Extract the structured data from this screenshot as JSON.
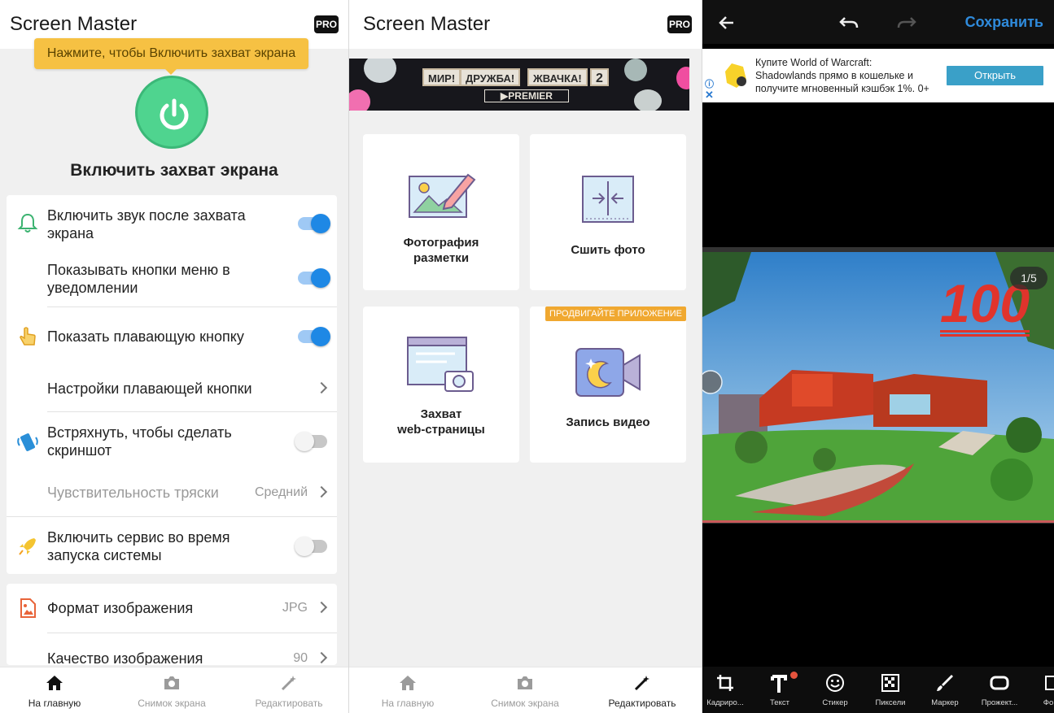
{
  "screen1": {
    "app_title": "Screen Master",
    "pro_badge": "PRO",
    "tooltip": "Нажмите, чтобы Включить захват экрана",
    "power_title": "Включить захват экрана",
    "settings": {
      "sound_after_capture": {
        "label_line1": "Включить звук после захвата",
        "label_line2": "экрана",
        "enabled": true
      },
      "menu_buttons_in_notification": {
        "label_line1": "Показывать кнопки меню в",
        "label_line2": "уведомлении",
        "enabled": true
      },
      "floating_button": {
        "label": "Показать плавающую кнопку",
        "enabled": true
      },
      "floating_button_settings": {
        "label": "Настройки плавающей кнопки"
      },
      "shake_to_screenshot": {
        "label_line1": "Встряхнуть, чтобы сделать",
        "label_line2": "скриншот",
        "enabled": false
      },
      "shake_sensitivity": {
        "label": "Чувствительность тряски",
        "value": "Средний"
      },
      "start_on_boot": {
        "label_line1": "Включить сервис во время",
        "label_line2": "запуска системы",
        "enabled": false
      },
      "image_format": {
        "label": "Формат изображения",
        "value": "JPG"
      },
      "image_quality": {
        "label": "Качество изображения",
        "value": "90"
      }
    },
    "nav": {
      "home": "На главную",
      "screenshot": "Снимок экрана",
      "edit": "Редактировать",
      "active": "home"
    }
  },
  "screen2": {
    "app_title": "Screen Master",
    "pro_badge": "PRO",
    "ad_banner": {
      "chips": [
        "МИР!",
        "ДРУЖБА!",
        "ЖВАЧКА!",
        "2"
      ],
      "sub": "▶PREMIER"
    },
    "tiles": [
      {
        "line1": "Фотография",
        "line2": "разметки",
        "icon": "markup-photo-icon"
      },
      {
        "line1": "Сшить фото",
        "line2": "",
        "icon": "stitch-photo-icon"
      },
      {
        "line1": "Захват",
        "line2": "web-страницы",
        "icon": "web-capture-icon"
      },
      {
        "line1": "Запись видео",
        "line2": "",
        "icon": "video-record-icon",
        "promo": "ПРОДВИГАЙТЕ ПРИЛОЖЕНИЕ"
      }
    ],
    "nav": {
      "home": "На главную",
      "screenshot": "Снимок экрана",
      "edit": "Редактировать",
      "active": "edit"
    }
  },
  "screen3": {
    "save_label": "Сохранить",
    "ad": {
      "line1": "Купите World of Warcraft:",
      "line2": "Shadowlands прямо в кошельке и",
      "line3": "получите мгновенный кэшбэк 1%. 0+",
      "button": "Открыть"
    },
    "page_indicator": "1/5",
    "photo_overlay_text": "100",
    "tools": [
      {
        "label": "Кадриро...",
        "icon": "crop-icon"
      },
      {
        "label": "Текст",
        "icon": "text-icon"
      },
      {
        "label": "Стикер",
        "icon": "sticker-icon"
      },
      {
        "label": "Пиксели",
        "icon": "pixelate-icon"
      },
      {
        "label": "Маркер",
        "icon": "marker-icon"
      },
      {
        "label": "Прожект...",
        "icon": "spotlight-icon"
      },
      {
        "label": "Фо",
        "icon": "photo-icon"
      }
    ]
  },
  "colors": {
    "accent_blue": "#1e88e5",
    "power_green": "#4fd48f",
    "tooltip_yellow": "#f6c143",
    "promo_orange": "#f0a830",
    "save_blue": "#2f8bdc"
  }
}
